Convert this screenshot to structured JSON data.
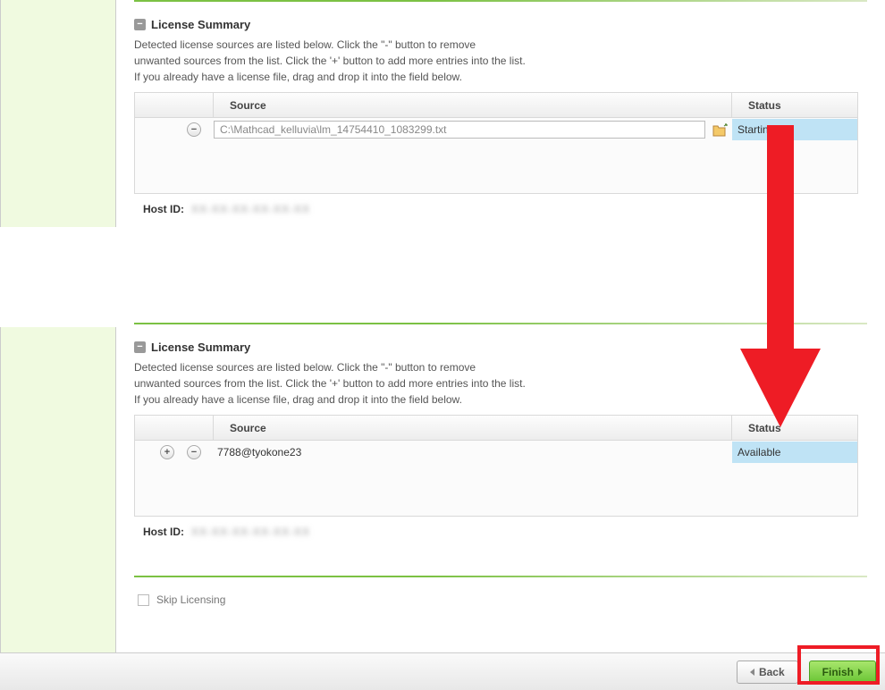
{
  "section1": {
    "title": "License Summary",
    "instructions_l1": "Detected license sources are listed below. Click the \"-\" button to remove",
    "instructions_l2": "unwanted sources from the list.  Click the '+' button to add more entries into the list.",
    "instructions_l3": "If you already have a license file, drag and drop it into the field below.",
    "col_source": "Source",
    "col_status": "Status",
    "source_value": "C:\\Mathcad_kelluvia\\lm_14754410_1083299.txt",
    "status_value": "Starting...",
    "host_label": "Host ID:",
    "host_value": "XX-XX-XX-XX-XX-XX"
  },
  "section2": {
    "title": "License Summary",
    "instructions_l1": "Detected license sources are listed below. Click the \"-\" button to remove",
    "instructions_l2": "unwanted sources from the list.  Click the '+' button to add more entries into the list.",
    "instructions_l3": "If you already have a license file, drag and drop it into the field below.",
    "col_source": "Source",
    "col_status": "Status",
    "source_value": "7788@tyokone23",
    "status_value": "Available",
    "host_label": "Host ID:",
    "host_value": "XX-XX-XX-XX-XX-XX",
    "skip_label": "Skip Licensing"
  },
  "footer": {
    "back": "Back",
    "finish": "Finish"
  }
}
